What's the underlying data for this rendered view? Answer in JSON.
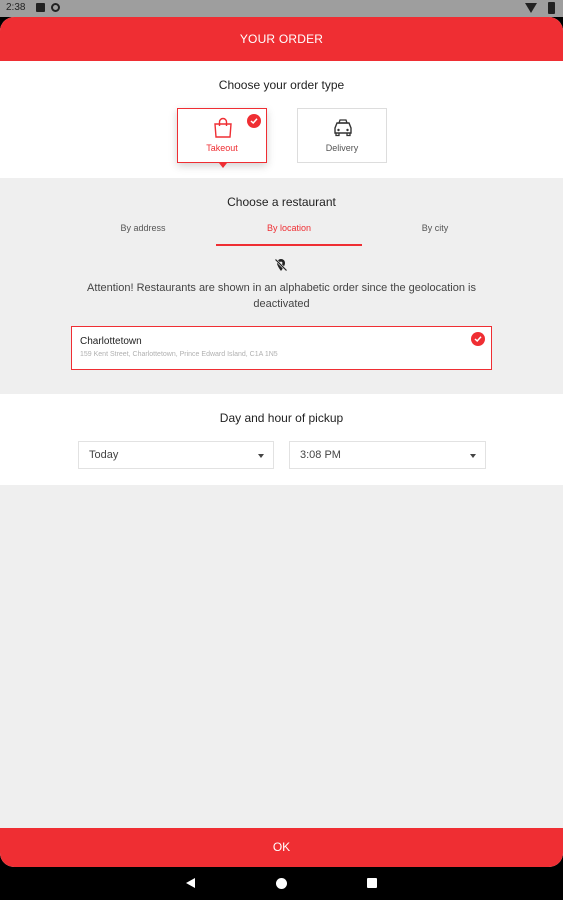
{
  "status_bar": {
    "time": "2:38",
    "icons": [
      "notification-icon",
      "circle-notification-icon",
      "wifi-icon",
      "battery-icon"
    ]
  },
  "header": {
    "title": "YOUR ORDER"
  },
  "order_type": {
    "title": "Choose your order type",
    "options": [
      {
        "label": "Takeout",
        "icon": "shopping-bag-icon",
        "selected": true
      },
      {
        "label": "Delivery",
        "icon": "car-icon",
        "selected": false
      }
    ]
  },
  "restaurant": {
    "title": "Choose a restaurant",
    "tabs": [
      {
        "label": "By address",
        "active": false
      },
      {
        "label": "By location",
        "active": true
      },
      {
        "label": "By city",
        "active": false
      }
    ],
    "geo_icon": "location-off-icon",
    "attention_text": "Attention! Restaurants are shown in an alphabetic order since the geolocation is deactivated",
    "selected": {
      "name": "Charlottetown",
      "address": "159 Kent Street, Charlottetown, Prince Edward Island, C1A 1N5"
    }
  },
  "pickup": {
    "title": "Day and hour of pickup",
    "day": "Today",
    "time": "3:08 PM"
  },
  "footer": {
    "ok_label": "OK"
  },
  "colors": {
    "accent": "#ef2e33",
    "background": "#efefef"
  }
}
